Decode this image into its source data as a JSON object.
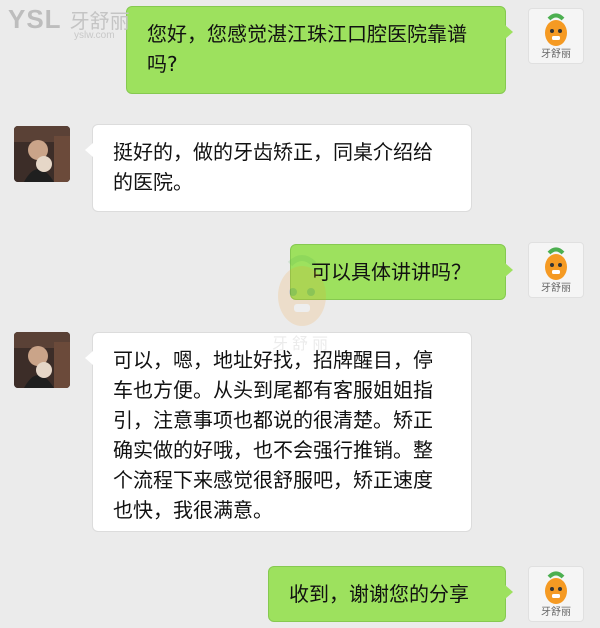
{
  "brand": {
    "name": "YSL",
    "cn_name": "牙舒丽",
    "url": "yslw.com"
  },
  "watermark": {
    "text": "牙舒丽"
  },
  "self_avatar": {
    "label": "牙舒丽",
    "icon": "carrot-mascot-icon"
  },
  "other_avatar": {
    "icon": "user-photo-avatar"
  },
  "messages": [
    {
      "from": "self",
      "text": "您好，您感觉湛江珠江口腔医院靠谱吗?"
    },
    {
      "from": "other",
      "text": "挺好的，做的牙齿矫正，同桌介绍给的医院。"
    },
    {
      "from": "self",
      "text": "可以具体讲讲吗？"
    },
    {
      "from": "other",
      "text": "可以，嗯，地址好找，招牌醒目，停车也方便。从头到尾都有客服姐姐指引，注意事项也都说的很清楚。矫正确实做的好哦，也不会强行推销。整个流程下来感觉很舒服吧，矫正速度也快，我很满意。"
    },
    {
      "from": "self",
      "text": "收到，谢谢您的分享"
    }
  ],
  "colors": {
    "background": "#ebebeb",
    "outgoing_bubble": "#9de15e",
    "incoming_bubble": "#ffffff",
    "mascot_orange": "#f59a23",
    "mascot_leaf": "#4caf50"
  }
}
